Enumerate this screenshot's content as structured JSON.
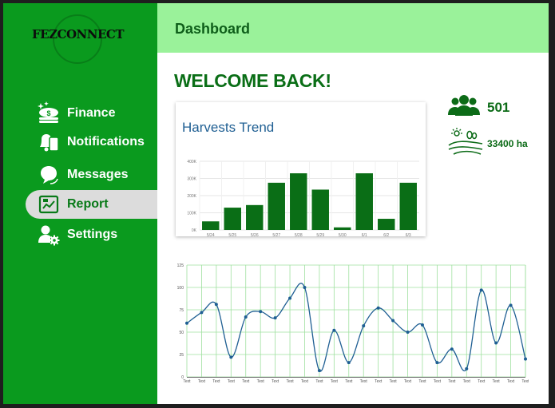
{
  "brand": {
    "logo_text": "FEZCONNECT"
  },
  "nav": {
    "items": [
      {
        "label": "Finance"
      },
      {
        "label": "Notifications"
      },
      {
        "label": "Messages"
      },
      {
        "label": "Report",
        "active": true
      },
      {
        "label": "Settings"
      }
    ]
  },
  "header": {
    "title": "Dashboard"
  },
  "welcome": "WELCOME BACK!",
  "stats": {
    "users": "501",
    "area": "33400 ha"
  },
  "colors": {
    "sidebar": "#0a9a1e",
    "topbar": "#9af29a",
    "bar": "#0a6e16",
    "line": "#1f5f93",
    "grid": "#9fe09f"
  },
  "chart_data": [
    {
      "type": "bar",
      "title": "Harvests Trend",
      "categories": [
        "5/24",
        "5/25",
        "5/26",
        "5/27",
        "5/28",
        "5/29",
        "5/30",
        "6/1",
        "6/2",
        "6/3"
      ],
      "values": [
        50000,
        130000,
        145000,
        275000,
        330000,
        235000,
        15000,
        330000,
        65000,
        275000
      ],
      "ylim": [
        0,
        400000
      ],
      "yticks": [
        "0K",
        "100K",
        "200K",
        "300K",
        "400K"
      ],
      "grid": true
    },
    {
      "type": "line",
      "categories": [
        "Text",
        "Text",
        "Text",
        "Text",
        "Text",
        "Text",
        "Text",
        "Text",
        "Text",
        "Text",
        "Text",
        "Text",
        "Text",
        "Text",
        "Text",
        "Text",
        "Text",
        "Text",
        "Text",
        "Text",
        "Text",
        "Text",
        "Text",
        "Text"
      ],
      "values": [
        60,
        72,
        81,
        22,
        67,
        73,
        66,
        88,
        100,
        7,
        52,
        16,
        57,
        77,
        63,
        50,
        58,
        16,
        31,
        9,
        97,
        38,
        80,
        20
      ],
      "ylim": [
        0,
        125
      ],
      "yticks": [
        "0",
        "25",
        "50",
        "75",
        "100",
        "125"
      ],
      "grid": true
    }
  ]
}
